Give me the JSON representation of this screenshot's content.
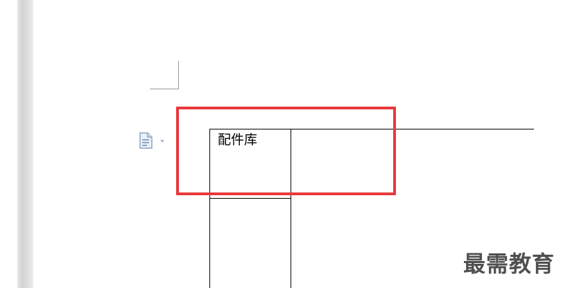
{
  "table": {
    "cell_1_1_text": "配件库"
  },
  "paste_options": {
    "icon": "document-paste-icon",
    "dropdown_icon": "chevron-down-icon"
  },
  "annotation": {
    "highlight_color": "#e8383d"
  },
  "watermark": {
    "text": "最需教育"
  }
}
